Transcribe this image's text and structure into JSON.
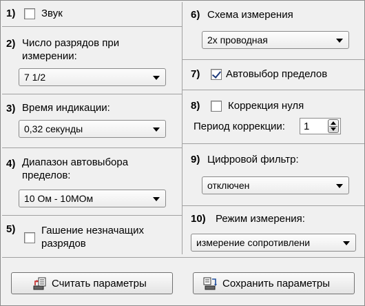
{
  "left": {
    "s1": {
      "num": "1)",
      "label": "Звук",
      "checked": false
    },
    "s2": {
      "num": "2)",
      "label_line1": "Число разрядов при",
      "label_line2": "измерении:",
      "value": "7 1/2"
    },
    "s3": {
      "num": "3)",
      "label": "Время индикации:",
      "value": "0,32 секунды"
    },
    "s4": {
      "num": "4)",
      "label_line1": "Диапазон автовыбора",
      "label_line2": "пределов:",
      "value": "10 Ом - 10МОм"
    },
    "s5": {
      "num": "5)",
      "label_line1": "Гашение незначащих",
      "label_line2": "разрядов",
      "checked": false
    }
  },
  "right": {
    "s6": {
      "num": "6)",
      "label": "Схема измерения",
      "value": "2х проводная"
    },
    "s7": {
      "num": "7)",
      "label": "Автовыбор пределов",
      "checked": true
    },
    "s8": {
      "num": "8)",
      "label": "Коррекция нуля",
      "checked": false,
      "period_label": "Период коррекции:",
      "period_value": "1"
    },
    "s9": {
      "num": "9)",
      "label": "Цифровой фильтр:",
      "value": "отключен"
    },
    "s10": {
      "num": "10)",
      "label": "Режим измерения:",
      "value": "измерение сопротивлени"
    }
  },
  "buttons": {
    "read": "Считать параметры",
    "save": "Сохранить параметры"
  },
  "icons": {
    "read": "read-params-icon",
    "save": "save-params-icon"
  }
}
